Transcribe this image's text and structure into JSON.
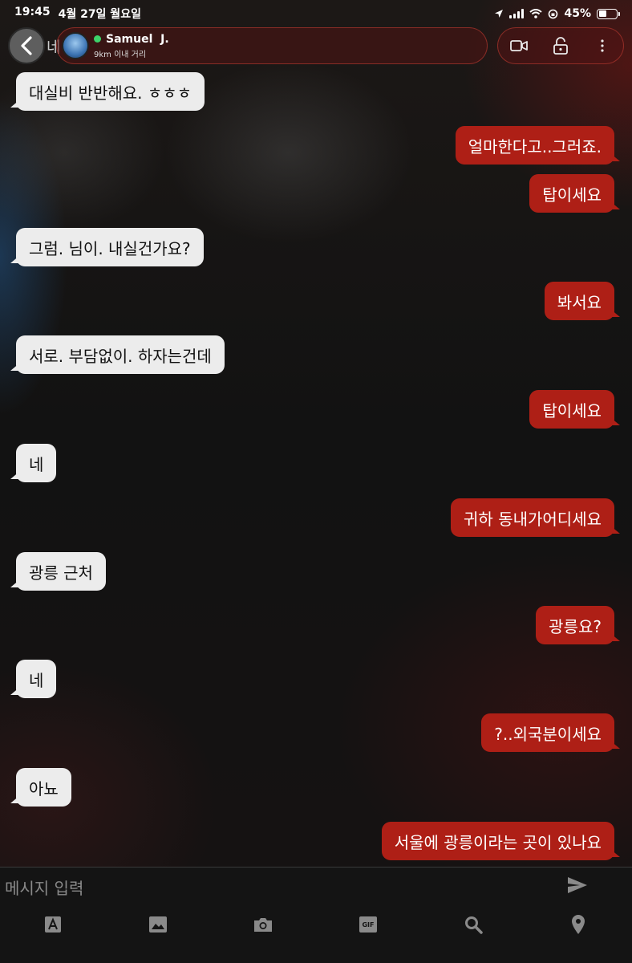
{
  "status_bar": {
    "time": "19:45",
    "date": "4월 27일 월요일",
    "battery": "45%",
    "battery_level": 0.45
  },
  "header": {
    "back_ghost_text": "네",
    "contact_name": "Samuel  J.",
    "distance": "9km 이내 거리",
    "online": true,
    "online_color": "#3dd36a"
  },
  "icons": {
    "back": "chevron-left-icon",
    "video": "video-camera-icon",
    "lock": "lock-icon",
    "more": "more-vertical-icon",
    "send": "send-icon",
    "text_style": "text-a-icon",
    "gallery": "image-icon",
    "camera": "camera-icon",
    "gif": "gif-icon",
    "search": "search-icon",
    "location": "location-pin-icon"
  },
  "colors": {
    "incoming_bubble": "#ececec",
    "outgoing_bubble": "#ae1f16",
    "header_border": "#be3c32"
  },
  "messages": [
    {
      "side": "in",
      "text": "대실비 반반해요. ㅎㅎㅎ"
    },
    {
      "side": "out",
      "text": "얼마한다고..그러죠."
    },
    {
      "side": "out",
      "text": "탑이세요"
    },
    {
      "side": "in",
      "text": "그럼. 님이. 내실건가요?"
    },
    {
      "side": "out",
      "text": "봐서요"
    },
    {
      "side": "in",
      "text": "서로. 부담없이. 하자는건데"
    },
    {
      "side": "out",
      "text": "탑이세요"
    },
    {
      "side": "in",
      "text": "네"
    },
    {
      "side": "out",
      "text": "귀하 동내가어디세요"
    },
    {
      "side": "in",
      "text": "광릉 근처"
    },
    {
      "side": "out",
      "text": "광릉요?"
    },
    {
      "side": "in",
      "text": "네"
    },
    {
      "side": "out",
      "text": "?..외국분이세요"
    },
    {
      "side": "in",
      "text": "아뇨"
    },
    {
      "side": "out",
      "text": "서울에 광릉이라는 곳이 있나요"
    }
  ],
  "composer": {
    "placeholder": "메시지 입력",
    "toolbar_gif_label": "GIF"
  }
}
